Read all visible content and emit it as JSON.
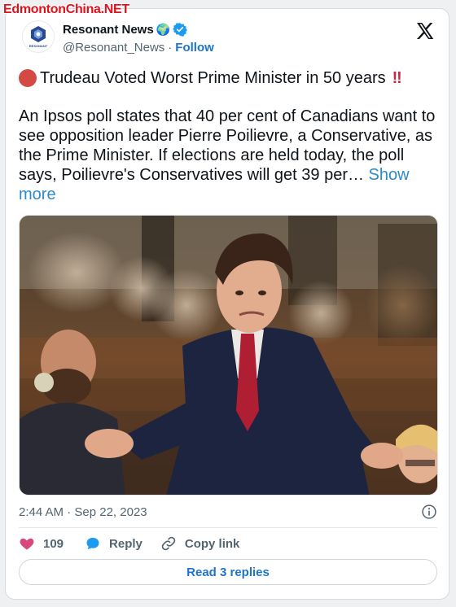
{
  "watermark": "EdmontonChina.NET",
  "header": {
    "display_name": "Resonant News",
    "globe_emoji": "🌍",
    "handle": "@Resonant_News",
    "separator": "·",
    "follow_label": "Follow",
    "avatar_text": "RESONANT"
  },
  "tweet": {
    "title": "Trudeau Voted Worst Prime Minister in 50 years",
    "title_suffix": "‼",
    "body": "An Ipsos poll states that 40 per cent of Canadians want to see opposition leader Pierre Poilievre, a Conservative, as the Prime Minister. If elections are held today, the poll says, Poilievre's Conservatives will get 39 per… ",
    "show_more": "Show more"
  },
  "meta": {
    "time": "2:44 AM",
    "separator": "·",
    "date": "Sep 22, 2023"
  },
  "actions": {
    "likes_count": "109",
    "reply_label": "Reply",
    "copy_link_label": "Copy link"
  },
  "read_replies_label": "Read 3 replies",
  "colors": {
    "link_blue": "#1d74c8",
    "heart": "#d7487d",
    "reply_bubble": "#1d9bf0",
    "watermark_red": "#e0121e"
  },
  "icons": [
    "x-logo-icon",
    "verified-badge-icon",
    "red-circle-icon",
    "heart-icon",
    "reply-bubble-icon",
    "link-icon",
    "info-icon"
  ]
}
